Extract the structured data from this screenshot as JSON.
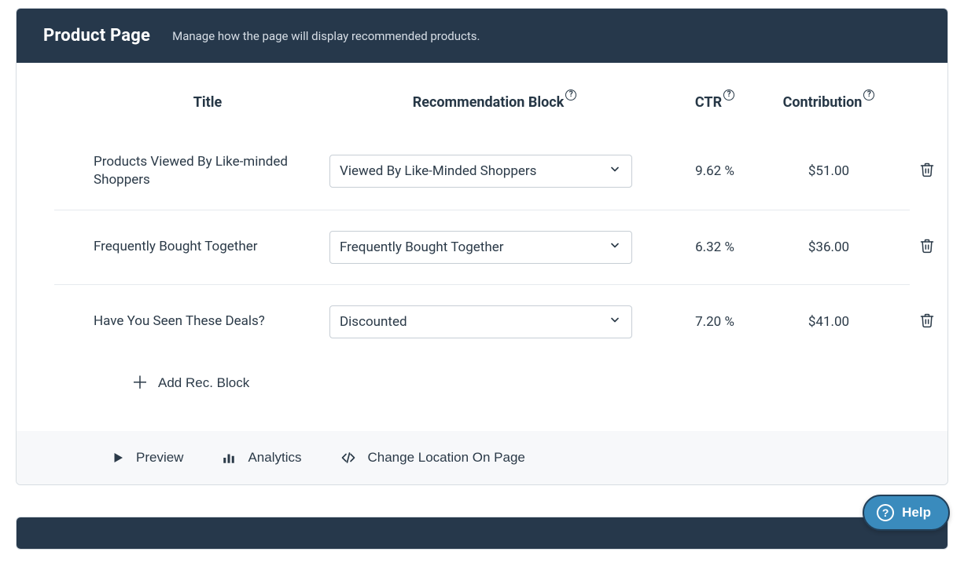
{
  "header": {
    "title": "Product Page",
    "subtitle": "Manage how the page will display recommended products."
  },
  "columns": {
    "title": "Title",
    "block": "Recommendation Block",
    "ctr": "CTR",
    "contribution": "Contribution"
  },
  "rows": [
    {
      "title": "Products Viewed By Like-minded Shoppers",
      "block": "Viewed By Like-Minded Shoppers",
      "ctr": "9.62 %",
      "contribution": "$51.00"
    },
    {
      "title": "Frequently Bought Together",
      "block": "Frequently Bought Together",
      "ctr": "6.32 %",
      "contribution": "$36.00"
    },
    {
      "title": "Have You Seen These Deals?",
      "block": "Discounted",
      "ctr": "7.20 %",
      "contribution": "$41.00"
    }
  ],
  "add_label": "Add Rec. Block",
  "footer": {
    "preview": "Preview",
    "analytics": "Analytics",
    "change_location": "Change Location On Page"
  },
  "help_label": "Help"
}
